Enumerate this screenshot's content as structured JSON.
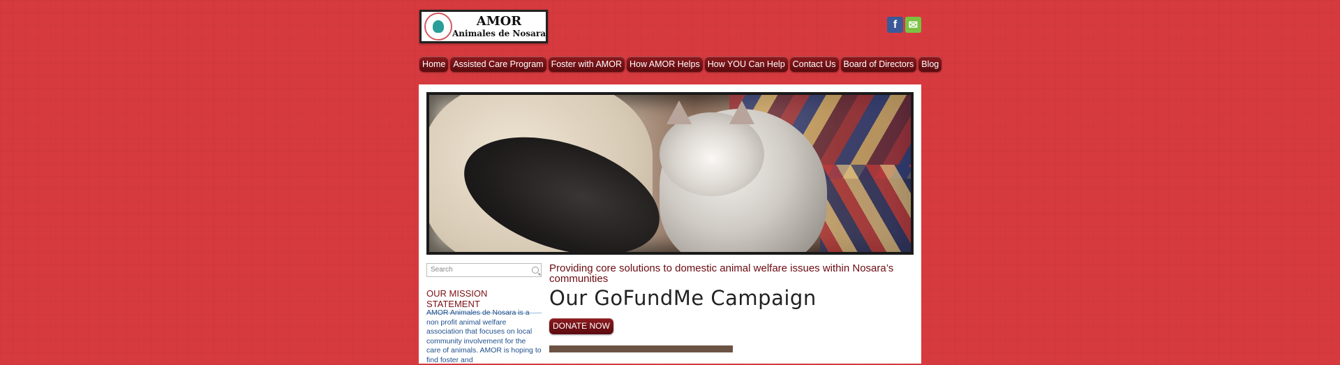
{
  "site": {
    "logo_title": "AMOR",
    "logo_subtitle": "Animales de Nosara"
  },
  "social": [
    {
      "name": "facebook-icon",
      "glyph": "f",
      "color": "#3b5998"
    },
    {
      "name": "email-icon",
      "glyph": "✉",
      "color": "#7ac142"
    }
  ],
  "nav": {
    "items": [
      {
        "label": "Home"
      },
      {
        "label": "Assisted Care Program"
      },
      {
        "label": "Foster with AMOR"
      },
      {
        "label": "How AMOR Helps"
      },
      {
        "label": "How YOU Can Help"
      },
      {
        "label": "Contact Us"
      },
      {
        "label": "Board of Directors"
      },
      {
        "label": "Blog"
      }
    ]
  },
  "sidebar": {
    "search_placeholder": "Search",
    "mission_title": "OUR MISSION STATEMENT",
    "mission_text": "AMOR Animales de Nosara is a non profit animal welfare association that focuses on local community involvement for the care of animals. AMOR is hoping to find foster and"
  },
  "main": {
    "tagline": "Providing core solutions to domestic animal welfare issues within Nosara’s communities",
    "heading": "Our GoFundMe Campaign",
    "donate_label": "DONATE NOW"
  },
  "colors": {
    "background": "#d63a3e",
    "nav": "#7a1418",
    "accent_text": "#6b0a10",
    "link_text": "#1f4f8c"
  }
}
